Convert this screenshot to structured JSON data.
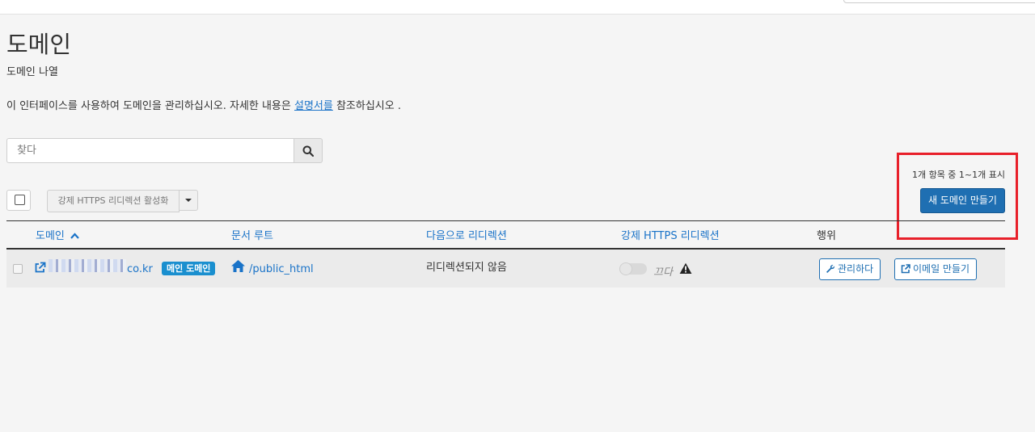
{
  "page": {
    "title": "도메인",
    "subtitle": "도메인 나열",
    "description_before": "이 인터페이스를 사용하여 도메인을 관리하십시오. 자세한 내용은 ",
    "description_link": "설명서를",
    "description_after": " 참조하십시오 ."
  },
  "search": {
    "placeholder": "찾다",
    "value": ""
  },
  "toolbar": {
    "https_button": "강제 HTTPS 리디렉션 활성화",
    "count_text": "1개 항목 중 1~1개 표시",
    "create_button": "새 도메인 만들기"
  },
  "table": {
    "headers": {
      "domain": "도메인",
      "docroot": "문서 루트",
      "redirect": "다음으로 리디렉션",
      "https": "강제 HTTPS 리디렉션",
      "actions": "행위"
    },
    "rows": [
      {
        "domain_suffix": "co.kr",
        "badge": "메인 도메인",
        "docroot": "/public_html",
        "redirect": "리디렉션되지 않음",
        "https_state": "끄다",
        "manage_label": "관리하다",
        "email_label": "이메일 만들기"
      }
    ]
  },
  "colors": {
    "primary": "#1f6fb2",
    "link": "#1a73c8",
    "badge": "#1a8fcf",
    "highlight": "#e8202a",
    "background": "#f5f5f5"
  },
  "icons": [
    "search-icon",
    "external-link-icon",
    "home-icon",
    "warning-icon",
    "wrench-icon",
    "sort-up-icon",
    "caret-down-icon"
  ]
}
